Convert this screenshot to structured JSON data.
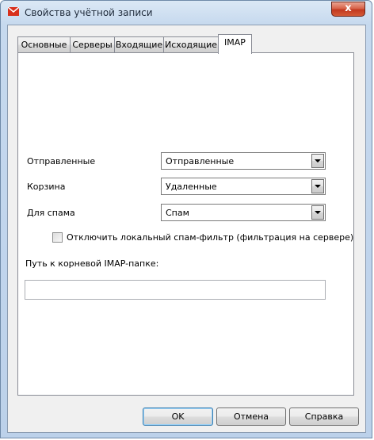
{
  "window": {
    "title": "Свойства учётной записи",
    "close_glyph": "x"
  },
  "tabs": [
    {
      "label": "Основные",
      "active": false
    },
    {
      "label": "Серверы",
      "active": false
    },
    {
      "label": "Входящие",
      "active": false
    },
    {
      "label": "Исходящие",
      "active": false
    },
    {
      "label": "IMAP",
      "active": true
    }
  ],
  "folders": {
    "sent_label": "Отправленные",
    "sent_value": "Отправленные",
    "trash_label": "Корзина",
    "trash_value": "Удаленные",
    "spam_label": "Для спама",
    "spam_value": "Спам"
  },
  "spam_filter": {
    "label": "Отключить локальный спам-фильтр (фильтрация на сервере)",
    "checked": false
  },
  "root_path": {
    "label": "Путь к корневой IMAP-папке:",
    "value": ""
  },
  "buttons": {
    "ok": "OK",
    "cancel": "Отмена",
    "help": "Справка"
  },
  "icons": {
    "app": "envelope-icon",
    "combo_arrow": "chevron-down-icon",
    "close": "close-icon"
  }
}
